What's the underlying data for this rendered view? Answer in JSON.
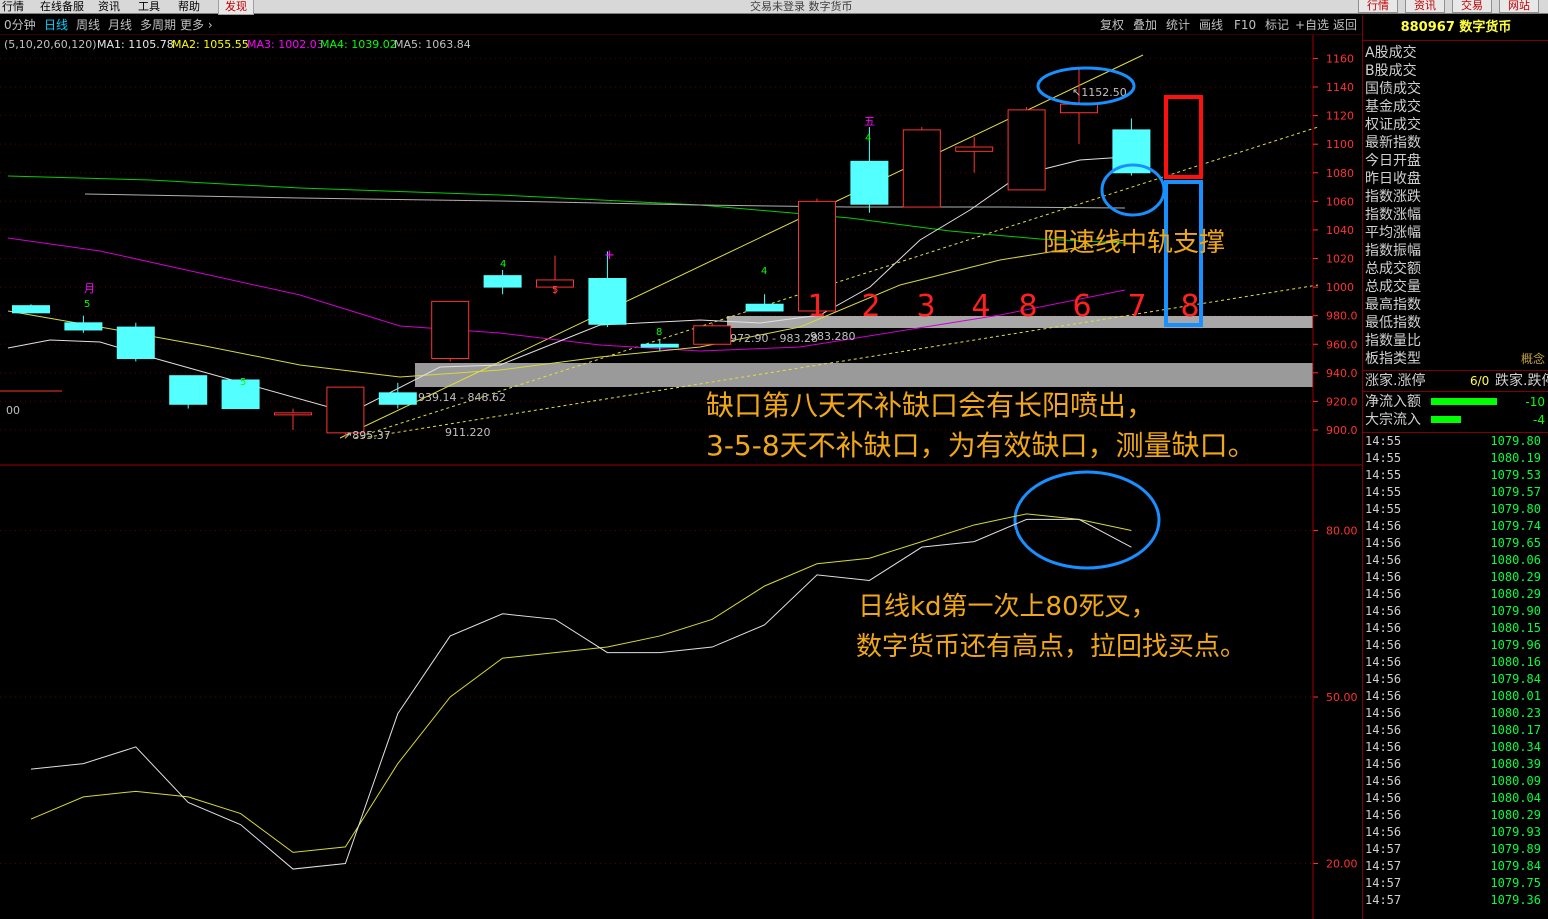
{
  "menu": {
    "items": [
      "行情",
      "在线备服",
      "资讯",
      "工具",
      "帮助"
    ],
    "alert": "发现",
    "window_title": "交易未登录  数字货币",
    "right_buttons": [
      "行情",
      "资讯",
      "交易",
      "网站"
    ]
  },
  "toolbar": {
    "periods": [
      "0分钟",
      "日线",
      "周线",
      "月线",
      "多周期",
      "更多 ›"
    ],
    "active_period": "日线",
    "tools": [
      "复权",
      "叠加",
      "统计",
      "画线",
      "F10",
      "标记",
      "+自选",
      "返回"
    ]
  },
  "ma_legend": {
    "params": "(5,10,20,60,120)",
    "items": [
      {
        "label": "MA1: 1105.78",
        "color": "#e8e8e8"
      },
      {
        "label": "MA2: 1055.55",
        "color": "#ffff00"
      },
      {
        "label": "MA3: 1002.03",
        "color": "#ff00ff"
      },
      {
        "label": "MA4: 1039.02",
        "color": "#00ff00"
      },
      {
        "label": "MA5: 1063.84",
        "color": "#c0c0c0"
      }
    ]
  },
  "price_axis": {
    "ticks": [
      900,
      920,
      940,
      960,
      980,
      1000,
      1020,
      1040,
      1060,
      1080,
      1100,
      1120,
      1140,
      1160
    ],
    "labels": [
      "900.0",
      "920.0",
      "940.0",
      "960.0",
      "980.0",
      "1000",
      "1020",
      "1040",
      "1060",
      "1080",
      "1100",
      "1120",
      "1140",
      "1160"
    ]
  },
  "kd_axis": {
    "ticks": [
      20,
      50,
      80
    ],
    "labels": [
      "20.00",
      "50.00",
      "80.00"
    ]
  },
  "chart_data": {
    "type": "candlestick",
    "price_range": [
      900,
      1168
    ],
    "candles": [
      {
        "o": 987,
        "h": 988,
        "l": 982,
        "c": 982,
        "up": false
      },
      {
        "o": 975,
        "h": 980,
        "l": 968,
        "c": 970,
        "up": false
      },
      {
        "o": 972,
        "h": 975,
        "l": 948,
        "c": 950,
        "up": false
      },
      {
        "o": 938,
        "h": 938,
        "l": 915,
        "c": 918,
        "up": false
      },
      {
        "o": 935,
        "h": 935,
        "l": 915,
        "c": 915,
        "up": false
      },
      {
        "o": 912,
        "h": 915,
        "l": 900,
        "c": 912,
        "up": true
      },
      {
        "o": 898,
        "h": 930,
        "l": 895.37,
        "c": 930,
        "up": true
      },
      {
        "o": 926,
        "h": 933,
        "l": 915,
        "c": 918,
        "up": false
      },
      {
        "o": 950,
        "h": 990,
        "l": 948,
        "c": 990,
        "up": true
      },
      {
        "o": 1008,
        "h": 1012,
        "l": 995,
        "c": 1000,
        "up": false
      },
      {
        "o": 1000,
        "h": 1022,
        "l": 995,
        "c": 1005,
        "up": true
      },
      {
        "o": 1006,
        "h": 1025,
        "l": 972,
        "c": 974,
        "up": false
      },
      {
        "o": 960,
        "h": 963,
        "l": 955,
        "c": 958,
        "up": false
      },
      {
        "o": 960,
        "h": 975,
        "l": 960,
        "c": 972.9,
        "up": true
      },
      {
        "o": 988,
        "h": 995,
        "l": 983.28,
        "c": 983.28,
        "up": false
      },
      {
        "o": 983.28,
        "h": 1062,
        "l": 983.28,
        "c": 1060,
        "up": true
      },
      {
        "o": 1088,
        "h": 1112,
        "l": 1052,
        "c": 1058,
        "up": false
      },
      {
        "o": 1056,
        "h": 1112,
        "l": 1056,
        "c": 1110,
        "up": true
      },
      {
        "o": 1095,
        "h": 1105,
        "l": 1080,
        "c": 1098,
        "up": true
      },
      {
        "o": 1068,
        "h": 1126,
        "l": 1068,
        "c": 1124,
        "up": true
      },
      {
        "o": 1122,
        "h": 1152.5,
        "l": 1100,
        "c": 1128,
        "up": true
      },
      {
        "o": 1110,
        "h": 1118,
        "l": 1078,
        "c": 1080,
        "up": false
      }
    ],
    "price_labels": [
      "1152.50",
      "939.14",
      "848.62",
      "895.37",
      "911.220",
      "972.90",
      "983.28",
      "983.280"
    ],
    "kd_k": [
      37,
      38,
      41,
      31,
      27,
      19,
      20,
      47,
      61,
      65,
      64,
      58,
      58,
      59,
      63,
      72,
      71,
      77,
      78,
      82,
      82,
      77
    ],
    "kd_d": [
      28,
      32,
      33,
      32,
      29,
      22,
      23,
      38,
      50,
      57,
      58,
      59,
      61,
      64,
      70,
      74,
      75,
      78,
      81,
      83,
      82,
      80
    ]
  },
  "candle_marks": [
    {
      "text": "月",
      "color": "#ff00ff"
    },
    {
      "text": "5",
      "color": "#00ff00"
    },
    {
      "text": "5",
      "color": "#00ff00"
    },
    {
      "text": "4",
      "color": "#00ff00"
    },
    {
      "text": "5",
      "color": "#ff4040"
    },
    {
      "text": "+",
      "color": "#ff00ff"
    },
    {
      "text": "8",
      "color": "#00ff00"
    },
    {
      "text": "4",
      "color": "#00ff00"
    },
    {
      "text": "五",
      "color": "#ff00ff"
    },
    {
      "text": "4",
      "color": "#00ff00"
    }
  ],
  "day_numbers": [
    "1",
    "2",
    "3",
    "4",
    "8",
    "6",
    "7",
    "8"
  ],
  "annotations": {
    "support": "阻速线中轨支撑",
    "gap_line1": "缺口第八天不补缺口会有长阳喷出，",
    "gap_line2": "3-5-8天不补缺口，为有效缺口，测量缺口。",
    "kd_line1": "日线kd第一次上80死叉，",
    "kd_line2": "数字货币还有高点，拉回找买点。"
  },
  "left_edge_label": "00",
  "right_panel": {
    "title": "880967 数字货币",
    "fields": [
      "A股成交",
      "B股成交",
      "国债成交",
      "基金成交",
      "权证成交",
      "最新指数",
      "今日开盘",
      "昨日收盘",
      "指数涨跌",
      "指数涨幅",
      "平均涨幅",
      "指数振幅",
      "总成交额",
      "总成交量",
      "最高指数",
      "最低指数",
      "指数量比",
      "板指类型"
    ],
    "board_type": "概念",
    "rise_label": "涨家.涨停",
    "rise_value": "6/0",
    "fall_label": "跌家.跌停",
    "net_inflow_label": "净流入额",
    "net_inflow_value": "-10",
    "block_inflow_label": "大宗流入",
    "block_inflow_value": "-4",
    "ticks": [
      {
        "t": "14:55",
        "p": "1079.80"
      },
      {
        "t": "14:55",
        "p": "1080.19"
      },
      {
        "t": "14:55",
        "p": "1079.53"
      },
      {
        "t": "14:55",
        "p": "1079.57"
      },
      {
        "t": "14:55",
        "p": "1079.80"
      },
      {
        "t": "14:56",
        "p": "1079.74"
      },
      {
        "t": "14:56",
        "p": "1079.65"
      },
      {
        "t": "14:56",
        "p": "1080.06"
      },
      {
        "t": "14:56",
        "p": "1080.29"
      },
      {
        "t": "14:56",
        "p": "1080.29"
      },
      {
        "t": "14:56",
        "p": "1079.90"
      },
      {
        "t": "14:56",
        "p": "1080.15"
      },
      {
        "t": "14:56",
        "p": "1079.96"
      },
      {
        "t": "14:56",
        "p": "1080.16"
      },
      {
        "t": "14:56",
        "p": "1079.84"
      },
      {
        "t": "14:56",
        "p": "1080.01"
      },
      {
        "t": "14:56",
        "p": "1080.23"
      },
      {
        "t": "14:56",
        "p": "1080.17"
      },
      {
        "t": "14:56",
        "p": "1080.34"
      },
      {
        "t": "14:56",
        "p": "1080.39"
      },
      {
        "t": "14:56",
        "p": "1080.09"
      },
      {
        "t": "14:56",
        "p": "1080.04"
      },
      {
        "t": "14:56",
        "p": "1080.29"
      },
      {
        "t": "14:56",
        "p": "1079.93"
      },
      {
        "t": "14:57",
        "p": "1079.89"
      },
      {
        "t": "14:57",
        "p": "1079.84"
      },
      {
        "t": "14:57",
        "p": "1079.75"
      },
      {
        "t": "14:57",
        "p": "1079.36"
      }
    ]
  },
  "colors": {
    "up": "#ff3232",
    "down": "#54ffff",
    "grid": "#5a0000",
    "axis": "#ff3232"
  }
}
